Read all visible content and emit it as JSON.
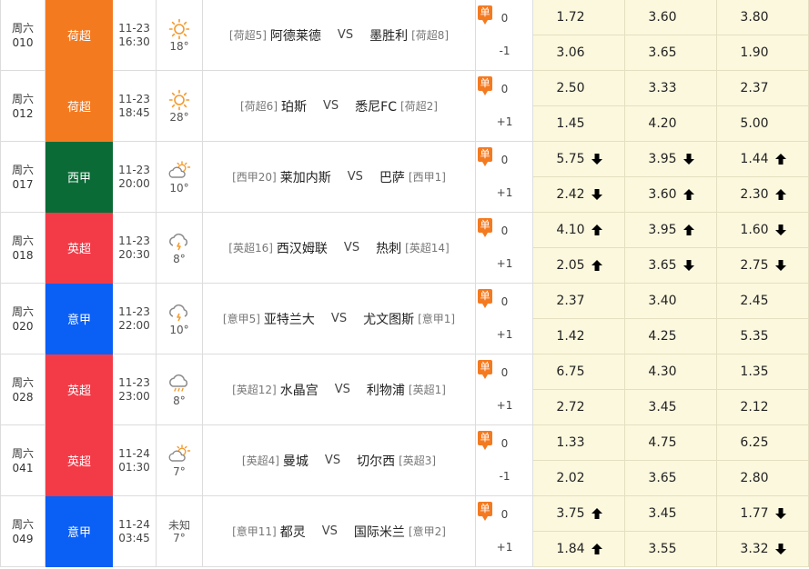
{
  "colors": {
    "orange_league": "#f47a20",
    "green_league": "#0a6b36",
    "red_league": "#f33b48",
    "blue_league": "#0a5ff5",
    "odds_bg": "#fcf8de",
    "arrow_up": "#f07820",
    "arrow_down": "#2aa12f"
  },
  "dan_label": "单",
  "vs_label": "VS",
  "matches": [
    {
      "day": "周六",
      "num": "010",
      "league": "荷超",
      "league_color": "#f47a20",
      "date": "11-23",
      "time": "16:30",
      "weather": "sun-icon",
      "temp": "18°",
      "home_rank": "[荷超5]",
      "home": "阿德莱德",
      "away": "墨胜利",
      "away_rank": "[荷超8]",
      "hc1": "0",
      "hc2": "-1",
      "odds1": [
        {
          "v": "1.72",
          "d": ""
        },
        {
          "v": "3.60",
          "d": ""
        },
        {
          "v": "3.80",
          "d": ""
        }
      ],
      "odds2": [
        {
          "v": "3.06",
          "d": ""
        },
        {
          "v": "3.65",
          "d": ""
        },
        {
          "v": "1.90",
          "d": ""
        }
      ]
    },
    {
      "day": "周六",
      "num": "012",
      "league": "荷超",
      "league_color": "#f47a20",
      "date": "11-23",
      "time": "18:45",
      "weather": "sun-icon",
      "temp": "28°",
      "home_rank": "[荷超6]",
      "home": "珀斯",
      "away": "悉尼FC",
      "away_rank": "[荷超2]",
      "hc1": "0",
      "hc2": "+1",
      "odds1": [
        {
          "v": "2.50",
          "d": ""
        },
        {
          "v": "3.33",
          "d": ""
        },
        {
          "v": "2.37",
          "d": ""
        }
      ],
      "odds2": [
        {
          "v": "1.45",
          "d": ""
        },
        {
          "v": "4.20",
          "d": ""
        },
        {
          "v": "5.00",
          "d": ""
        }
      ]
    },
    {
      "day": "周六",
      "num": "017",
      "league": "西甲",
      "league_color": "#0a6b36",
      "date": "11-23",
      "time": "20:00",
      "weather": "partly-cloudy-icon",
      "temp": "10°",
      "home_rank": "[西甲20]",
      "home": "莱加内斯",
      "away": "巴萨",
      "away_rank": "[西甲1]",
      "hc1": "0",
      "hc2": "+1",
      "odds1": [
        {
          "v": "5.75",
          "d": "down"
        },
        {
          "v": "3.95",
          "d": "down"
        },
        {
          "v": "1.44",
          "d": "up"
        }
      ],
      "odds2": [
        {
          "v": "2.42",
          "d": "down"
        },
        {
          "v": "3.60",
          "d": "up"
        },
        {
          "v": "2.30",
          "d": "up"
        }
      ]
    },
    {
      "day": "周六",
      "num": "018",
      "league": "英超",
      "league_color": "#f33b48",
      "date": "11-23",
      "time": "20:30",
      "weather": "thunder-cloud-icon",
      "temp": "8°",
      "home_rank": "[英超16]",
      "home": "西汉姆联",
      "away": "热刺",
      "away_rank": "[英超14]",
      "hc1": "0",
      "hc2": "+1",
      "odds1": [
        {
          "v": "4.10",
          "d": "up"
        },
        {
          "v": "3.95",
          "d": "up"
        },
        {
          "v": "1.60",
          "d": "down"
        }
      ],
      "odds2": [
        {
          "v": "2.05",
          "d": "up"
        },
        {
          "v": "3.65",
          "d": "down"
        },
        {
          "v": "2.75",
          "d": "down"
        }
      ]
    },
    {
      "day": "周六",
      "num": "020",
      "league": "意甲",
      "league_color": "#0a5ff5",
      "date": "11-23",
      "time": "22:00",
      "weather": "thunder-cloud-icon",
      "temp": "10°",
      "home_rank": "[意甲5]",
      "home": "亚特兰大",
      "away": "尤文图斯",
      "away_rank": "[意甲1]",
      "hc1": "0",
      "hc2": "+1",
      "odds1": [
        {
          "v": "2.37",
          "d": ""
        },
        {
          "v": "3.40",
          "d": ""
        },
        {
          "v": "2.45",
          "d": ""
        }
      ],
      "odds2": [
        {
          "v": "1.42",
          "d": ""
        },
        {
          "v": "4.25",
          "d": ""
        },
        {
          "v": "5.35",
          "d": ""
        }
      ]
    },
    {
      "day": "周六",
      "num": "028",
      "league": "英超",
      "league_color": "#f33b48",
      "date": "11-23",
      "time": "23:00",
      "weather": "rain-cloud-icon",
      "temp": "8°",
      "home_rank": "[英超12]",
      "home": "水晶宫",
      "away": "利物浦",
      "away_rank": "[英超1]",
      "hc1": "0",
      "hc2": "+1",
      "odds1": [
        {
          "v": "6.75",
          "d": ""
        },
        {
          "v": "4.30",
          "d": ""
        },
        {
          "v": "1.35",
          "d": ""
        }
      ],
      "odds2": [
        {
          "v": "2.72",
          "d": ""
        },
        {
          "v": "3.45",
          "d": ""
        },
        {
          "v": "2.12",
          "d": ""
        }
      ]
    },
    {
      "day": "周六",
      "num": "041",
      "league": "英超",
      "league_color": "#f33b48",
      "date": "11-24",
      "time": "01:30",
      "weather": "partly-cloudy-icon",
      "temp": "7°",
      "home_rank": "[英超4]",
      "home": "曼城",
      "away": "切尔西",
      "away_rank": "[英超3]",
      "hc1": "0",
      "hc2": "-1",
      "odds1": [
        {
          "v": "1.33",
          "d": ""
        },
        {
          "v": "4.75",
          "d": ""
        },
        {
          "v": "6.25",
          "d": ""
        }
      ],
      "odds2": [
        {
          "v": "2.02",
          "d": ""
        },
        {
          "v": "3.65",
          "d": ""
        },
        {
          "v": "2.80",
          "d": ""
        }
      ]
    },
    {
      "day": "周六",
      "num": "049",
      "league": "意甲",
      "league_color": "#0a5ff5",
      "date": "11-24",
      "time": "03:45",
      "weather": "",
      "weather_text": "未知",
      "temp": "7°",
      "home_rank": "[意甲11]",
      "home": "都灵",
      "away": "国际米兰",
      "away_rank": "[意甲2]",
      "hc1": "0",
      "hc2": "+1",
      "odds1": [
        {
          "v": "3.75",
          "d": "up"
        },
        {
          "v": "3.45",
          "d": ""
        },
        {
          "v": "1.77",
          "d": "down"
        }
      ],
      "odds2": [
        {
          "v": "1.84",
          "d": "up"
        },
        {
          "v": "3.55",
          "d": ""
        },
        {
          "v": "3.32",
          "d": "down"
        }
      ]
    }
  ]
}
